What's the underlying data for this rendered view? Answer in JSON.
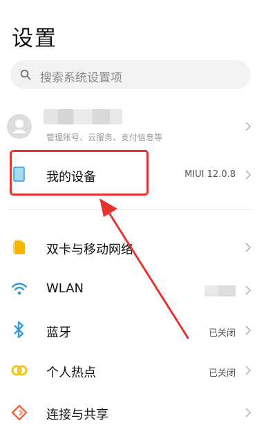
{
  "header": {
    "title": "设置"
  },
  "search": {
    "placeholder": "搜索系统设置项",
    "icon": "search-icon"
  },
  "account": {
    "subtitle": "管理账号、云服务、支付信息等",
    "icon": "avatar-icon"
  },
  "settings": {
    "my_device": {
      "label": "我的设备",
      "value": "MIUI 12.0.8",
      "icon": "phone-icon"
    },
    "dual_sim": {
      "label": "双卡与移动网络",
      "icon": "sim-card-icon"
    },
    "wlan": {
      "label": "WLAN",
      "icon": "wifi-icon"
    },
    "bluetooth": {
      "label": "蓝牙",
      "value": "已关闭",
      "icon": "bluetooth-icon"
    },
    "hotspot": {
      "label": "个人热点",
      "value": "已关闭",
      "icon": "hotspot-icon"
    },
    "connection_sharing": {
      "label": "连接与共享",
      "icon": "share-icon"
    }
  },
  "colors": {
    "annotation_red": "#e8322e",
    "accent_blue": "#2d9cdb",
    "sim_yellow": "#f5b400",
    "hotspot_yellow": "#f0c419",
    "share_orange": "#ee6a3c"
  }
}
